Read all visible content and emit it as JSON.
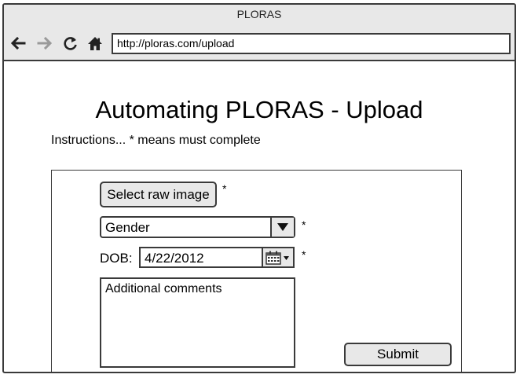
{
  "window": {
    "title": "PLORAS"
  },
  "browser": {
    "url": "http://ploras.com/upload",
    "icons": [
      "back-arrow-icon",
      "forward-arrow-icon",
      "reload-icon",
      "home-icon"
    ]
  },
  "page": {
    "title": "Automating PLORAS - Upload",
    "instructions": "Instructions... * means must complete"
  },
  "form": {
    "select_image_label": "Select raw image",
    "required_marker": "*",
    "gender_selected": "Gender",
    "dob_label": "DOB:",
    "dob_value": "4/22/2012",
    "comments_placeholder": "Additional comments",
    "submit_label": "Submit"
  },
  "colors": {
    "chrome_bg": "#e8e8e8",
    "border": "#3a3a3a",
    "disabled_arrow": "#9a9a9a"
  }
}
